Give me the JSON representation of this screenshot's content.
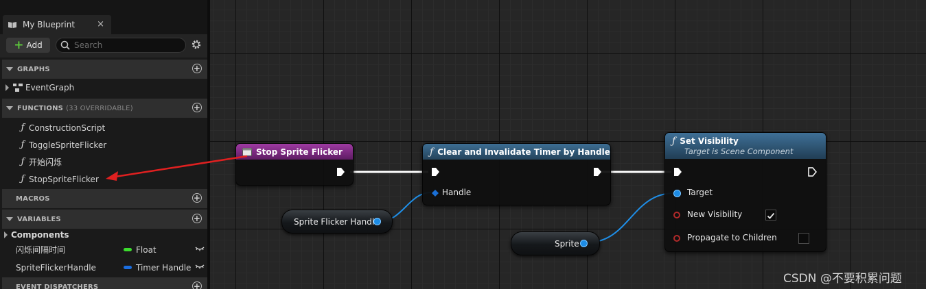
{
  "panel": {
    "tab_title": "My Blueprint",
    "tab_close": "×",
    "add_label": "Add",
    "search_placeholder": "Search",
    "sections": {
      "graphs": {
        "title": "GRAPHS",
        "items": [
          "EventGraph"
        ]
      },
      "functions": {
        "title": "FUNCTIONS",
        "subtitle": "(33 OVERRIDABLE)",
        "items": [
          "ConstructionScript",
          "ToggleSpriteFlicker",
          "开始闪烁",
          "StopSpriteFlicker"
        ]
      },
      "macros": {
        "title": "MACROS"
      },
      "variables": {
        "title": "VARIABLES",
        "category": "Components",
        "items": [
          {
            "name": "闪烁间隔时间",
            "type": "Float",
            "color": "#3cdc2e"
          },
          {
            "name": "SpriteFlickerHandle",
            "type": "Timer Handle",
            "color": "#1b6ee0"
          }
        ]
      },
      "dispatchers": {
        "title": "EVENT DISPATCHERS"
      }
    }
  },
  "graph": {
    "nodes": {
      "stop": {
        "title": "Stop Sprite Flicker",
        "header_color": "#8a2d8e"
      },
      "clear": {
        "title": "Clear and Invalidate Timer by Handle",
        "pin_handle": "Handle"
      },
      "setvis": {
        "title": "Set Visibility",
        "subtitle": "Target is Scene Component",
        "pin_target": "Target",
        "pin_new_visibility": "New Visibility",
        "pin_propagate": "Propagate to Children",
        "new_visibility_checked": true,
        "propagate_checked": false
      },
      "sprite_handle_var": {
        "label": "Sprite Flicker Handle"
      },
      "sprite_var": {
        "label": "Sprite"
      }
    },
    "colors": {
      "exec_wire": "#ffffff",
      "object_wire": "#1f8fe8",
      "struct_pin": "#1a6fd6",
      "annotation_arrow": "#e02020"
    }
  },
  "watermark": "CSDN @不要积累问题"
}
